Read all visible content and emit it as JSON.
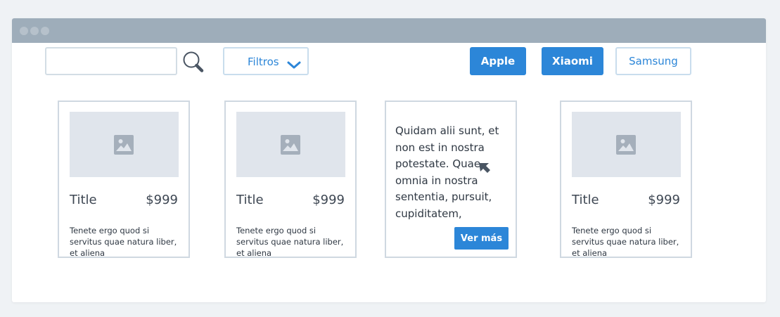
{
  "toolbar": {
    "search_value": "",
    "filter_label": "Filtros",
    "brands": [
      {
        "label": "Apple",
        "selected": true
      },
      {
        "label": "Xiaomi",
        "selected": true
      },
      {
        "label": "Samsung",
        "selected": false
      }
    ]
  },
  "cards": [
    {
      "title": "Title",
      "price": "$999",
      "description": "Tenete ergo quod si servitus quae natura liber, et aliena"
    },
    {
      "title": "Title",
      "price": "$999",
      "description": "Tenete ergo quod si servitus quae natura liber, et aliena"
    },
    {
      "hover_text": "Quidam alii sunt, et non est in nostra potestate. Quae omnia in nostra sententia, pursuit, cupiditatem,",
      "cta_label": "Ver más"
    },
    {
      "title": "Title",
      "price": "$999",
      "description": "Tenete ergo quod si servitus quae natura liber, et aliena"
    }
  ],
  "icons": {
    "search": "search-icon",
    "filter_dropdown": "chevron-down-icon",
    "thumbnail": "image-placeholder-icon",
    "cursor": "mouse-pointer-icon"
  },
  "colors": {
    "accent": "#2c86d8",
    "titlebar": "#9eadba",
    "placeholder_bg": "#e0e5ec",
    "text": "#3e4753"
  }
}
